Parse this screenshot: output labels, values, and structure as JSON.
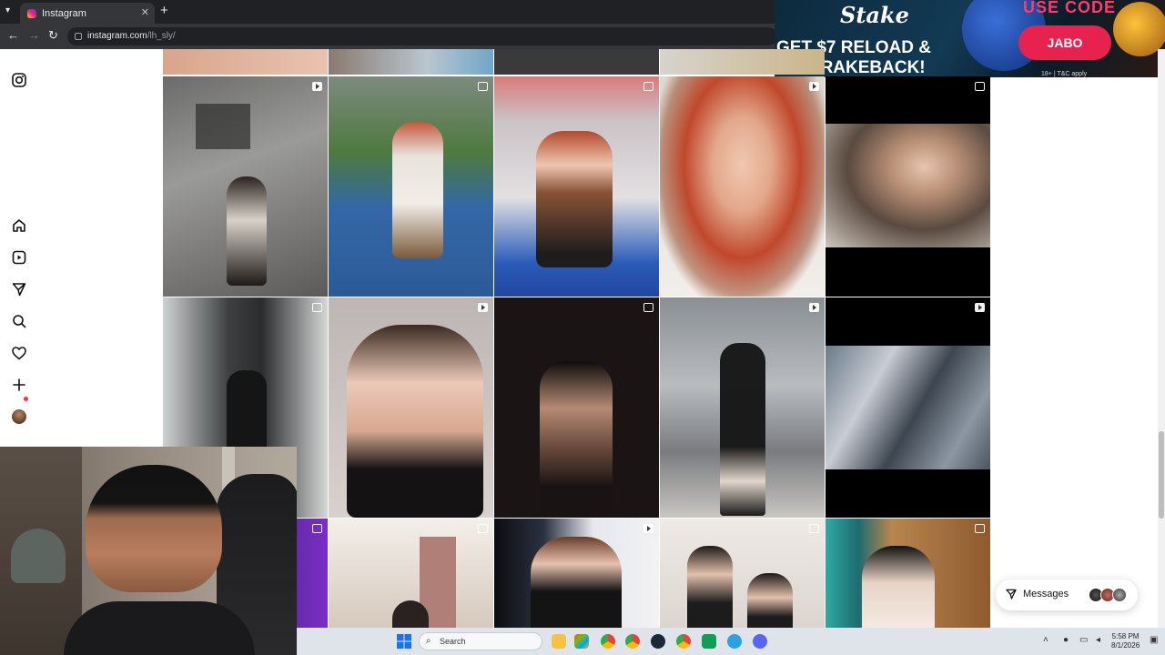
{
  "browser": {
    "tab_title": "Instagram",
    "tab_close": "✕",
    "new_tab": "+",
    "tab_menu": "▾",
    "url_host": "instagram.com",
    "url_path": "/lh_sly/",
    "back": "←",
    "forward": "→",
    "reload": "↻"
  },
  "ad": {
    "brand": "Stake",
    "headline": "GET $7 RELOAD & 3.5% RAKEBACK!",
    "use_code": "USE CODE",
    "code": "JABO",
    "disclaimer": "18+ | T&C apply"
  },
  "sidebar": {
    "icons": [
      "instagram-logo-icon",
      "home-icon",
      "reels-icon",
      "direct-icon",
      "search-icon",
      "notifications-icon",
      "create-icon",
      "profile-avatar"
    ]
  },
  "grid": {
    "post_types": [
      "reel",
      "carousel",
      "carousel",
      "reel",
      "carousel",
      "carousel",
      "reel",
      "carousel",
      "reel",
      "reel",
      "carousel",
      "carousel",
      "reel",
      "carousel",
      "carousel"
    ]
  },
  "messages": {
    "label": "Messages"
  },
  "taskbar": {
    "search_placeholder": "Search",
    "time": "5:58 PM",
    "date": "8/1/2026"
  },
  "colors": {
    "chrome_dark": "#202124",
    "chrome_toolbar": "#35363a",
    "ad_accent": "#e8224f",
    "notification_dot": "#ff3040"
  }
}
